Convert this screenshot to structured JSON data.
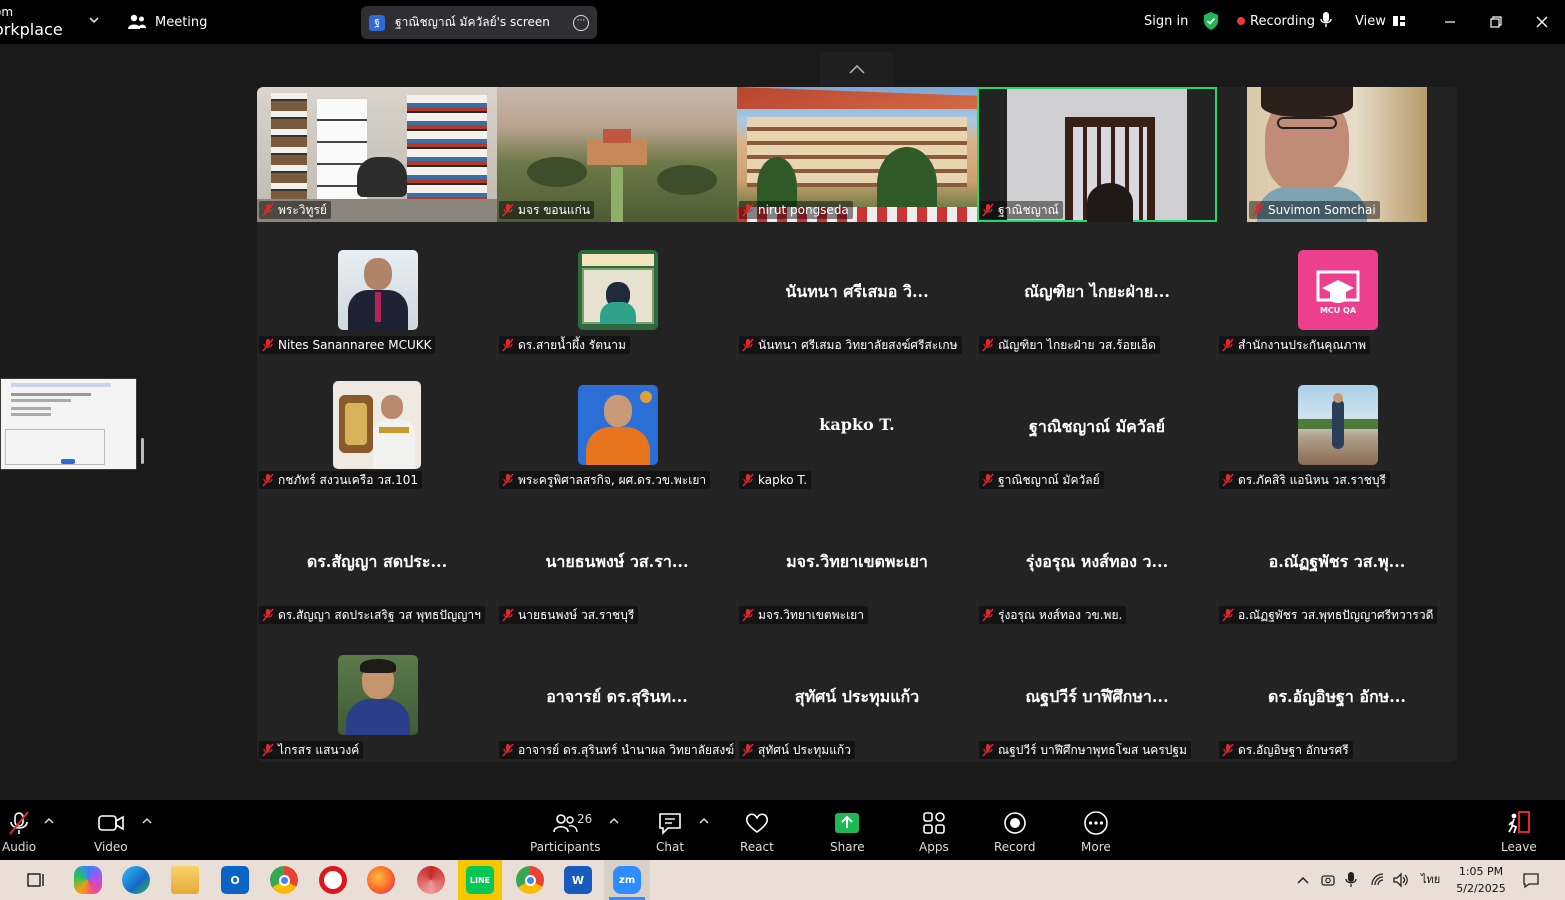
{
  "app": {
    "brand_line1": "om",
    "brand_line2": "orkplace",
    "meeting_label": "Meeting",
    "share_indicator": "ฐาณิชญาณ์ มัควัลย์'s screen",
    "sign_in": "Sign in",
    "recording_label": "Recording",
    "view_label": "View"
  },
  "colors": {
    "active_speaker": "#23d96b",
    "recording_dot": "#e8383d",
    "mic_off": "#e02828",
    "shield": "#1db954"
  },
  "video_tiles": [
    {
      "name": "พระวิทูรย์",
      "scene": "library"
    },
    {
      "name": "มจร ขอนแก่น",
      "scene": "aerial-campus"
    },
    {
      "name": "nirut pongseda",
      "scene": "thai-building"
    },
    {
      "name": "ฐาณิชญาณ์",
      "scene": "window-room",
      "active": true
    },
    {
      "name": "Suvimon Somchai",
      "scene": "webcam-face"
    }
  ],
  "grid_rows": [
    [
      {
        "name": "Nites Sanannaree MCUKK",
        "avatar": "portrait-suit"
      },
      {
        "name": "ดร.สายน้ำผึ้ง รัตนาม",
        "avatar": "portrait-green"
      },
      {
        "display": "นันทนา ศรีเสมอ วิ...",
        "name": "นันทนา ศรีเสมอ วิทยาลัยสงฆ์ศรีสะเกษ"
      },
      {
        "display": "ณัญฑิยา ไกยะฝ่าย...",
        "name": "ณัญฑิยา ไกยะฝ่าย วส.ร้อยเอ็ด"
      },
      {
        "name": "สำนักงานประกันคุณภาพ",
        "avatar": "mcu-qa-logo",
        "logo_text": "MCU QA"
      }
    ],
    [
      {
        "name": "กชภัทร์ สงวนเครือ วส.101",
        "avatar": "portrait-uniform"
      },
      {
        "name": "พระครูพิศาลสรกิจ, ผศ.ดร.วข.พะเยา",
        "avatar": "portrait-monk"
      },
      {
        "display": "kapko T.",
        "name": "kapko T."
      },
      {
        "display": "ฐาณิชญาณ์ มัควัลย์",
        "name": "ฐาณิชญาณ์ มัควัลย์"
      },
      {
        "name": "ดร.ภัคสิริ แอนิหน วส.ราชบุรี",
        "avatar": "portrait-outdoor"
      }
    ],
    [
      {
        "display": "ดร.สัญญา สดประ...",
        "name": "ดร.สัญญา สดประเสริฐ วส พุทธปัญญาฯ"
      },
      {
        "display": "นายธนพงษ์ วส.รา...",
        "name": "นายธนพงษ์ วส.ราชบุรี"
      },
      {
        "display": "มจร.วิทยาเขตพะเยา",
        "name": "มจร.วิทยาเขตพะเยา"
      },
      {
        "display": "รุ่งอรุณ หงส์ทอง ว...",
        "name": "รุ่งอรุณ หงส์ทอง วข.พย."
      },
      {
        "display": "อ.ณัฏฐพัชร วส.พุ...",
        "name": "อ.ณัฏฐพัชร วส.พุทธปัญญาศรีทวารวดี"
      }
    ],
    [
      {
        "name": "ไกรสร แสนวงค์",
        "avatar": "portrait-young"
      },
      {
        "display": "อาจารย์ ดร.สุรินท...",
        "name": "อาจารย์ ดร.สุรินทร์ นำนาผล วิทยาลัยสงฆ์..."
      },
      {
        "display": "สุทัศน์ ประทุมแก้ว",
        "name": "สุทัศน์ ประทุมแก้ว"
      },
      {
        "display": "ณฐปวีร์ บาฬีศึกษา...",
        "name": "ณฐปวีร์ บาฬีศึกษาพุทธโฆส นครปฐม"
      },
      {
        "display": "ดร.อัญอิษฐา อักษ...",
        "name": "ดร.อัญอิษฐา อักษรศรี"
      }
    ]
  ],
  "controls": {
    "audio": "Audio",
    "video": "Video",
    "participants": "Participants",
    "participants_count": "26",
    "chat": "Chat",
    "react": "React",
    "share": "Share",
    "apps": "Apps",
    "record": "Record",
    "more": "More",
    "leave": "Leave"
  },
  "taskbar": {
    "apps": [
      "task-view",
      "copilot",
      "edge",
      "file-explorer",
      "outlook",
      "chrome",
      "opera",
      "firefox",
      "chromium",
      "line",
      "chrome-profile",
      "word",
      "zoom"
    ],
    "keyboard_lang": "ไทย",
    "time": "1:05 PM",
    "date": "5/2/2025"
  }
}
